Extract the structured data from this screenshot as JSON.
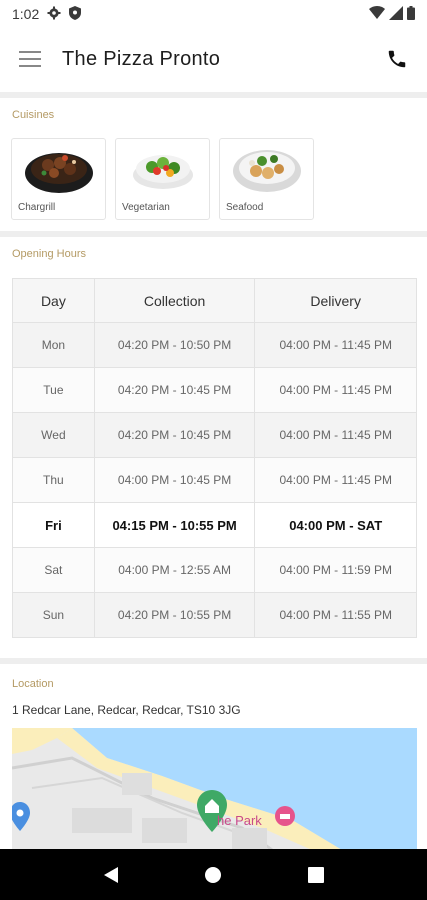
{
  "status_bar": {
    "time": "1:02"
  },
  "header": {
    "title": "The Pizza Pronto"
  },
  "cuisines": {
    "heading": "Cuisines",
    "items": [
      {
        "label": "Chargrill",
        "icon": "chargrill-dish-image"
      },
      {
        "label": "Vegetarian",
        "icon": "vegetarian-dish-image"
      },
      {
        "label": "Seafood",
        "icon": "seafood-dish-image"
      }
    ]
  },
  "opening_hours": {
    "heading": "Opening Hours",
    "columns": [
      "Day",
      "Collection",
      "Delivery"
    ],
    "rows": [
      {
        "day": "Mon",
        "collection": "04:20 PM - 10:50 PM",
        "delivery": "04:00 PM - 11:45 PM"
      },
      {
        "day": "Tue",
        "collection": "04:20 PM - 10:45 PM",
        "delivery": "04:00 PM - 11:45 PM"
      },
      {
        "day": "Wed",
        "collection": "04:20 PM - 10:45 PM",
        "delivery": "04:00 PM - 11:45 PM"
      },
      {
        "day": "Thu",
        "collection": "04:00 PM - 10:45 PM",
        "delivery": "04:00 PM - 11:45 PM"
      },
      {
        "day": "Fri",
        "collection": "04:15 PM - 10:55 PM",
        "delivery": "04:00 PM - SAT"
      },
      {
        "day": "Sat",
        "collection": "04:00 PM - 12:55 AM",
        "delivery": "04:00 PM - 11:59 PM"
      },
      {
        "day": "Sun",
        "collection": "04:20 PM - 10:55 PM",
        "delivery": "04:00 PM - 11:55 PM"
      }
    ],
    "highlighted_day": "Fri"
  },
  "location": {
    "heading": "Location",
    "address": "1 Redcar Lane, Redcar, Redcar, TS10 3JG",
    "map_label": "he Park"
  },
  "colors": {
    "section_heading": "#b49a64",
    "divider": "#eeeeee"
  }
}
